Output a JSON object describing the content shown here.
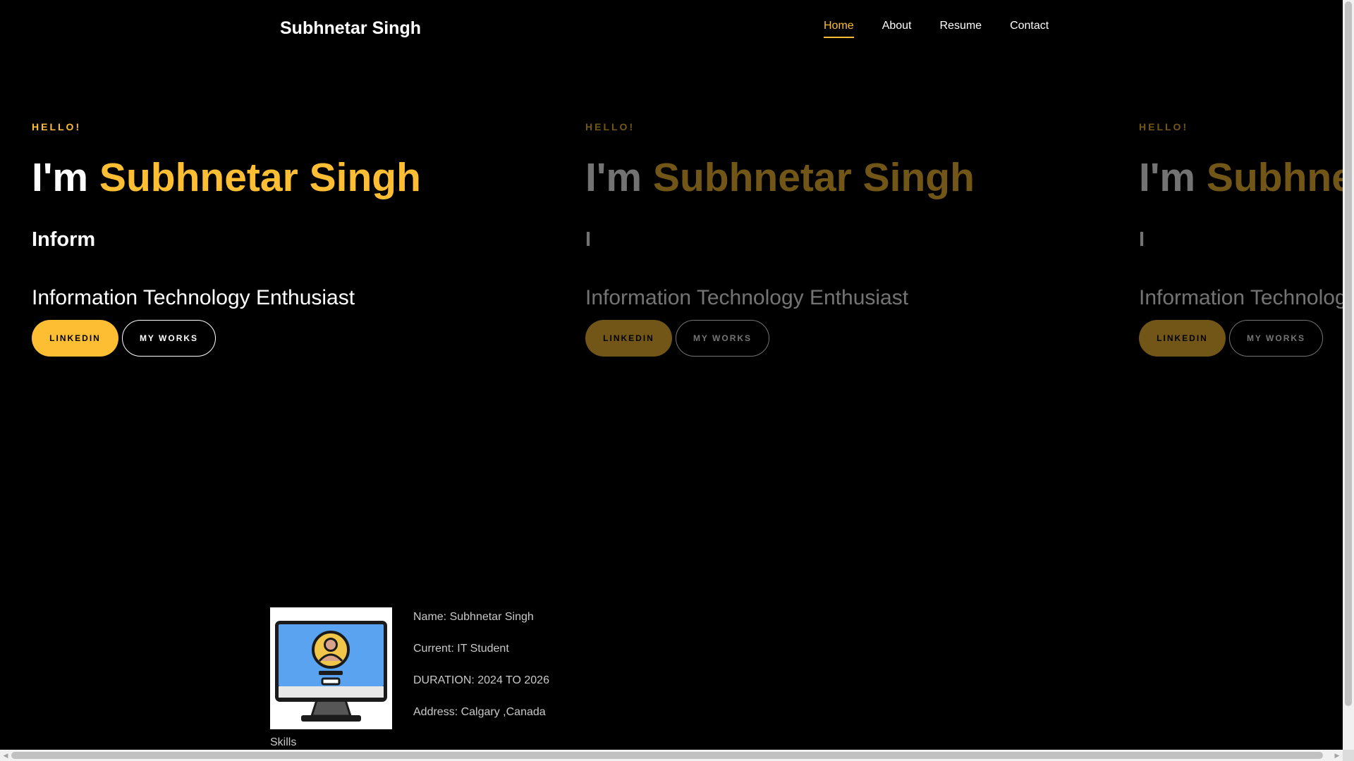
{
  "brand": "Subhnetar Singh",
  "nav": [
    "Home",
    "About",
    "Resume",
    "Contact"
  ],
  "hero": {
    "greeting": "HELLO!",
    "intro": "I'm",
    "name": "Subhnetar Singh",
    "slides": [
      {
        "typed": "Inform"
      },
      {
        "typed": "I"
      },
      {
        "typed": "I"
      }
    ],
    "subtitle": "Information Technology Enthusiast",
    "linkedin_label": "LINKEDIN",
    "works_label": "MY WORKS"
  },
  "about": {
    "image_icon": "computer-monitor-user-icon",
    "lines": [
      "Name: Subhnetar Singh",
      "Current: IT Student",
      "DURATION: 2024 TO 2026",
      "Address: Calgary ,Canada"
    ],
    "skills_label": "Skills"
  },
  "colors": {
    "background": "#000000",
    "accent": "#fdbe34",
    "text": "#ffffff"
  }
}
